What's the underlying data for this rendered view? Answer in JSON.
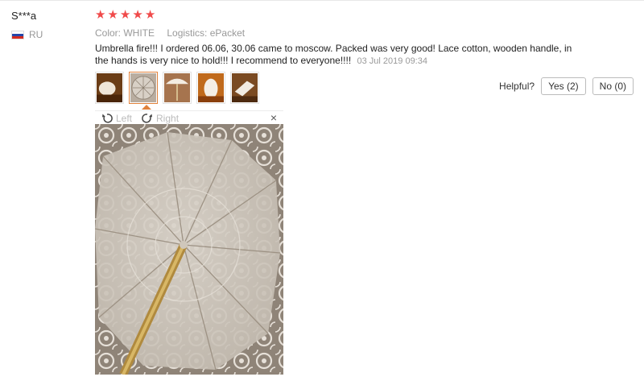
{
  "user": {
    "name": "S***a",
    "country": "RU"
  },
  "review": {
    "rating": 5,
    "color": "Color: WHITE",
    "logistics": "Logistics: ePacket",
    "text": "Umbrella fire!!! I ordered 06.06, 30.06 came to moscow. Packed was very good! Lace cotton, wooden handle, in the hands is very nice to hold!!! I recommend to everyone!!!!",
    "date": "03 Jul 2019 09:34"
  },
  "viewer": {
    "left_label": "Left",
    "right_label": "Right",
    "close_glyph": "×"
  },
  "helpful": {
    "label": "Helpful?",
    "yes_label": "Yes (2)",
    "no_label": "No (0)"
  },
  "thumbnails": [
    {
      "icon": "photo-thumbnail-1",
      "active": false
    },
    {
      "icon": "photo-thumbnail-2",
      "active": true
    },
    {
      "icon": "photo-thumbnail-3",
      "active": false
    },
    {
      "icon": "photo-thumbnail-4",
      "active": false
    },
    {
      "icon": "photo-thumbnail-5",
      "active": false
    }
  ],
  "colors": {
    "star": "#f04a4a",
    "accent": "#e0823c",
    "muted": "#999999"
  }
}
